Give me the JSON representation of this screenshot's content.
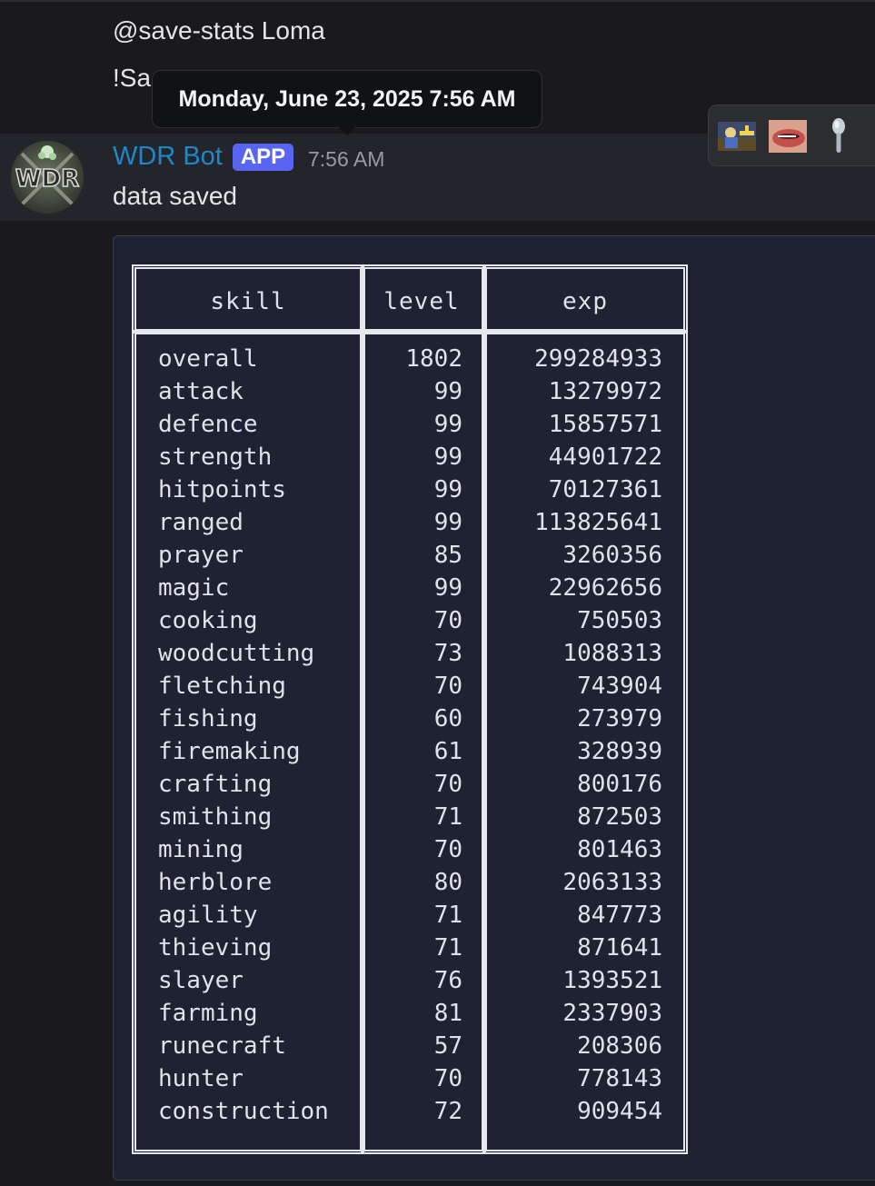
{
  "previous_message": {
    "line1": "@save-stats Loma",
    "line2": "!Sa"
  },
  "tooltip": {
    "text": "Monday, June 23, 2025 7:56 AM"
  },
  "message": {
    "username": "WDR Bot",
    "badge": "APP",
    "timestamp": "7:56 AM",
    "text": "data saved",
    "avatar_text": "WDR",
    "username_color": "#1c87c9",
    "badge_color": "#5865f2"
  },
  "reaction_bar": {
    "buttons": [
      "character-emoji-icon",
      "mouth-emoji-icon",
      "spoon-emoji-icon"
    ]
  },
  "table": {
    "headers": {
      "skill": "skill",
      "level": "level",
      "exp": "exp"
    },
    "rows": [
      {
        "skill": "overall",
        "level": "1802",
        "exp": "299284933"
      },
      {
        "skill": "attack",
        "level": "99",
        "exp": "13279972"
      },
      {
        "skill": "defence",
        "level": "99",
        "exp": "15857571"
      },
      {
        "skill": "strength",
        "level": "99",
        "exp": "44901722"
      },
      {
        "skill": "hitpoints",
        "level": "99",
        "exp": "70127361"
      },
      {
        "skill": "ranged",
        "level": "99",
        "exp": "113825641"
      },
      {
        "skill": "prayer",
        "level": "85",
        "exp": "3260356"
      },
      {
        "skill": "magic",
        "level": "99",
        "exp": "22962656"
      },
      {
        "skill": "cooking",
        "level": "70",
        "exp": "750503"
      },
      {
        "skill": "woodcutting",
        "level": "73",
        "exp": "1088313"
      },
      {
        "skill": "fletching",
        "level": "70",
        "exp": "743904"
      },
      {
        "skill": "fishing",
        "level": "60",
        "exp": "273979"
      },
      {
        "skill": "firemaking",
        "level": "61",
        "exp": "328939"
      },
      {
        "skill": "crafting",
        "level": "70",
        "exp": "800176"
      },
      {
        "skill": "smithing",
        "level": "71",
        "exp": "872503"
      },
      {
        "skill": "mining",
        "level": "70",
        "exp": "801463"
      },
      {
        "skill": "herblore",
        "level": "80",
        "exp": "2063133"
      },
      {
        "skill": "agility",
        "level": "71",
        "exp": "847773"
      },
      {
        "skill": "thieving",
        "level": "71",
        "exp": "871641"
      },
      {
        "skill": "slayer",
        "level": "76",
        "exp": "1393521"
      },
      {
        "skill": "farming",
        "level": "81",
        "exp": "2337903"
      },
      {
        "skill": "runecraft",
        "level": "57",
        "exp": "208306"
      },
      {
        "skill": "hunter",
        "level": "70",
        "exp": "778143"
      },
      {
        "skill": "construction",
        "level": "72",
        "exp": "909454"
      }
    ]
  }
}
